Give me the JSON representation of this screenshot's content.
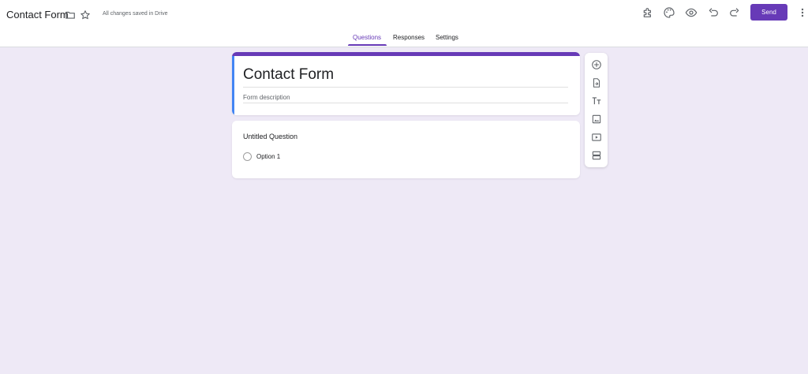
{
  "header": {
    "doc_title": "Contact Form",
    "save_status": "All changes saved in Drive",
    "send_label": "Send",
    "icons": [
      "folder-icon",
      "star-icon",
      "puzzle-icon",
      "palette-icon",
      "eye-icon",
      "undo-icon",
      "redo-icon",
      "more-vert-icon"
    ]
  },
  "tabs": [
    {
      "label": "Questions",
      "active": true
    },
    {
      "label": "Responses",
      "active": false
    },
    {
      "label": "Settings",
      "active": false
    }
  ],
  "form": {
    "title": "Contact Form",
    "description_placeholder": "Form description"
  },
  "question": {
    "title": "Untitled Question",
    "options": [
      "Option 1"
    ]
  },
  "side_toolbar": {
    "icons": [
      "add-question-icon",
      "import-questions-icon",
      "add-title-icon",
      "add-image-icon",
      "add-video-icon",
      "add-section-icon"
    ]
  },
  "colors": {
    "accent": "#673ab7",
    "blue_stripe": "#4285f4",
    "background": "#eee9f6"
  }
}
